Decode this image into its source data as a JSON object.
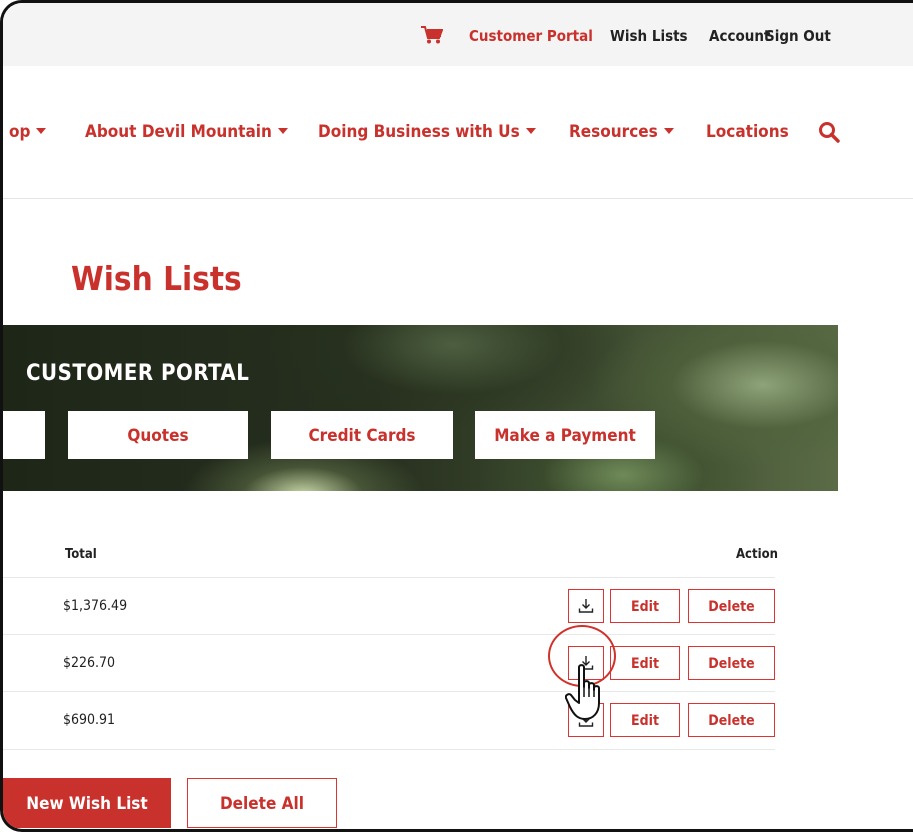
{
  "utility_nav": {
    "cart_icon": "cart-icon",
    "customer_portal": "Customer Portal",
    "wish_lists": "Wish Lists",
    "account": "Account",
    "sign_out": "Sign Out"
  },
  "main_nav": {
    "shop_partial": "op",
    "about": "About Devil Mountain",
    "doing_business": "Doing Business with Us",
    "resources": "Resources",
    "locations": "Locations",
    "search_icon": "search-icon"
  },
  "page_title": "Wish Lists",
  "banner": {
    "title": "CUSTOMER PORTAL",
    "buttons": [
      "Quotes",
      "Credit Cards",
      "Make a Payment"
    ]
  },
  "table": {
    "headers": {
      "total": "Total",
      "action": "Action"
    },
    "rows": [
      {
        "total": "$1,376.49",
        "edit": "Edit",
        "delete": "Delete"
      },
      {
        "total": "$226.70",
        "edit": "Edit",
        "delete": "Delete"
      },
      {
        "total": "$690.91",
        "edit": "Edit",
        "delete": "Delete"
      }
    ]
  },
  "actions": {
    "new_wish_list": "New Wish List",
    "delete_all": "Delete All"
  },
  "colors": {
    "brand_red": "#c9312c",
    "text_dark": "#222222",
    "utility_bg": "#f4f4f4"
  }
}
